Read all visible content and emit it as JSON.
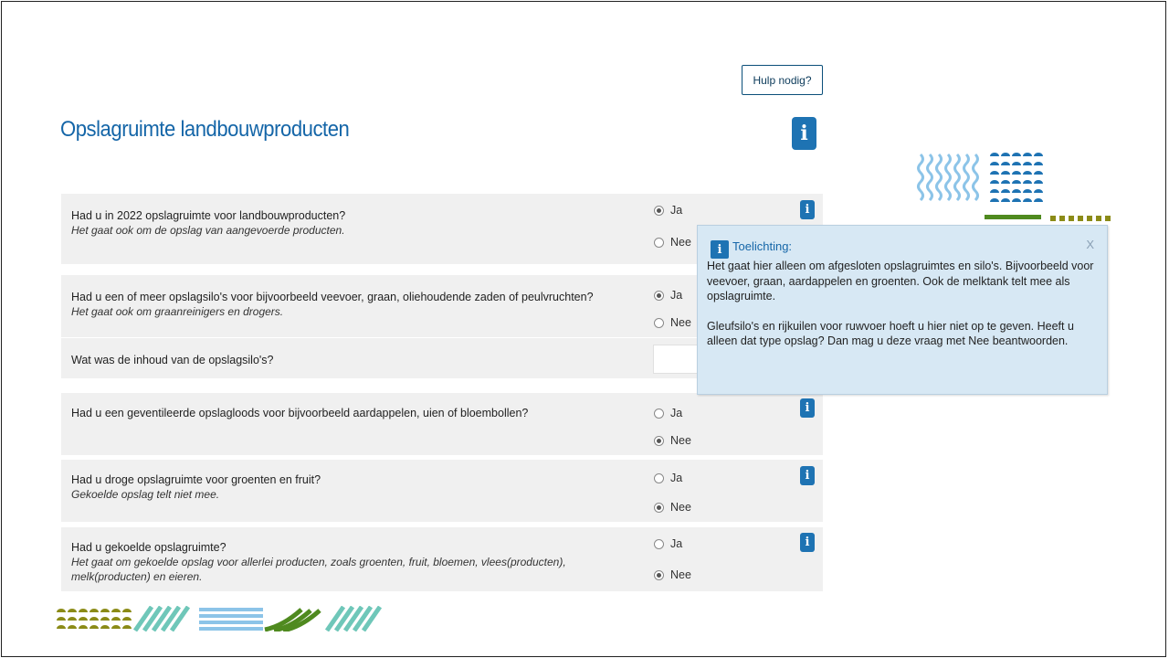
{
  "help_button": "Hulp nodig?",
  "page_title": "Opslagruimte landbouwproducten",
  "colors": {
    "title_blue": "#1566a8",
    "info_blue": "#1e73b3",
    "row_bg": "#f0f0f0",
    "tooltip_bg": "#d7e8f4",
    "deco_olive": "#8b8b17",
    "deco_green": "#4f8a1f",
    "deco_lightblue": "#8cc4e8",
    "deco_teal": "#6fc7b9",
    "deco_darkblue": "#1e73b3"
  },
  "radio_yes": "Ja",
  "radio_no": "Nee",
  "questions": [
    {
      "main": "Had u in 2022 opslagruimte voor landbouwproducten?",
      "sub": "Het gaat ook om de opslag van aangevoerde producten.",
      "selected": "Ja"
    },
    {
      "main": "Had u een of meer opslagsilo's voor bijvoorbeeld veevoer, graan, oliehoudende zaden of peulvruchten?",
      "sub": "Het gaat ook om graanreinigers en drogers.",
      "selected": "Ja"
    },
    {
      "main": "Wat was de inhoud van de opslagsilo's?",
      "sub": ""
    },
    {
      "main": "Had u een geventileerde opslagloods voor bijvoorbeeld aardappelen, uien of bloembollen?",
      "sub": "",
      "selected": "Nee"
    },
    {
      "main": "Had u droge opslagruimte voor groenten en fruit?",
      "sub": "Gekoelde opslag telt niet mee.",
      "selected": "Nee"
    },
    {
      "main": "Had u gekoelde opslagruimte?",
      "sub": "Het gaat om gekoelde opslag voor allerlei producten, zoals groenten, fruit, bloemen, vlees(producten), melk(producten) en eieren.",
      "selected": "Nee"
    }
  ],
  "tooltip": {
    "title": "Toelichting:",
    "close": "X",
    "paragraph1": "Het gaat hier alleen om afgesloten opslagruimtes en silo's. Bijvoorbeeld voor veevoer, graan, aardappelen en groenten. Ook de melktank telt mee als opslagruimte.",
    "paragraph2": "Gleufsilo's en rijkuilen voor ruwvoer hoeft u hier niet op te geven. Heeft u alleen dat type opslag? Dan mag u deze vraag met Nee beantwoorden."
  },
  "icons": {
    "info": "i"
  }
}
